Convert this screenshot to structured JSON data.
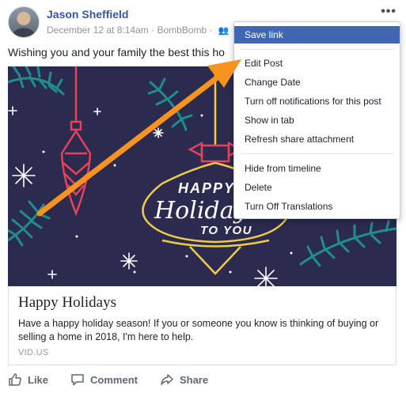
{
  "post": {
    "author": "Jason Sheffield",
    "date": "December 12 at 8:14am",
    "via": "BombBomb",
    "separator": "·",
    "text": "Wishing you and your family the best this ho"
  },
  "media": {
    "greeting_line1": "HAPPY",
    "greeting_line2": "Holidays",
    "greeting_line3": "TO YOU",
    "background_color": "#2b2a4f"
  },
  "link_card": {
    "title": "Happy Holidays",
    "description": "Have a happy holiday season! If you or someone you know is thinking of buying or selling a home in 2018, I'm here to help.",
    "domain": "VID.US"
  },
  "actions": {
    "like": "Like",
    "comment": "Comment",
    "share": "Share"
  },
  "menu": {
    "items": [
      "Save link",
      "Edit Post",
      "Change Date",
      "Turn off notifications for this post",
      "Show in tab",
      "Refresh share attachment",
      "Hide from timeline",
      "Delete",
      "Turn Off Translations"
    ],
    "active_item": "Save link"
  },
  "icons": {
    "more": "more-horizontal-icon",
    "audience": "friends-icon",
    "like": "thumbs-up-icon",
    "comment": "comment-bubble-icon",
    "share": "share-arrow-icon"
  },
  "colors": {
    "name_link": "#385898",
    "menu_highlight": "#4267b2",
    "annotation_arrow": "#f7931e"
  }
}
